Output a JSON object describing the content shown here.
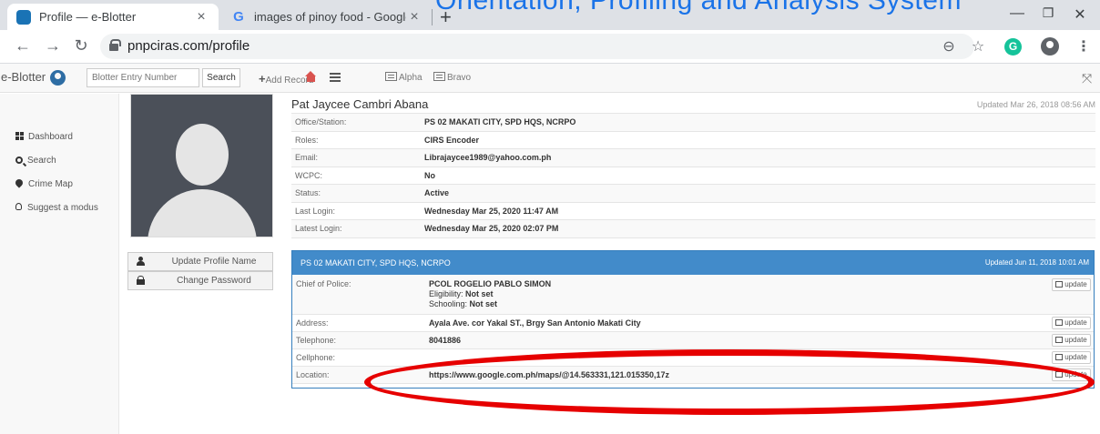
{
  "browser": {
    "tabs": [
      {
        "title": "Profile — e-Blotter",
        "active": true
      },
      {
        "title": "images of pinoy food - Google S",
        "active": false
      }
    ],
    "overlay_text": "Orientation, Profiling and Analysis System",
    "url": "pnpciras.com/profile",
    "colors": {
      "link_overlay": "#1a73e8",
      "tabstrip": "#dee1e6"
    }
  },
  "navbar": {
    "brand": "e-Blotter",
    "entry_placeholder": "Blotter Entry Number",
    "search_label": "Search",
    "add_record_label": "Add Record",
    "alpha_label": "Alpha",
    "bravo_label": "Bravo"
  },
  "sidebar": {
    "items": [
      {
        "label": "Dashboard",
        "icon": "grid-icon"
      },
      {
        "label": "Search",
        "icon": "search-icon"
      },
      {
        "label": "Crime Map",
        "icon": "map-marker-icon"
      },
      {
        "label": "Suggest a modus",
        "icon": "lightbulb-icon"
      }
    ]
  },
  "profile": {
    "buttons": {
      "update_name": "Update Profile Name",
      "change_password": "Change Password"
    },
    "name": "Pat Jaycee Cambri Abana",
    "updated": "Updated Mar 26, 2018 08:56 AM",
    "rows": [
      {
        "key": "Office/Station:",
        "value": "PS 02 MAKATI CITY, SPD HQS, NCRPO"
      },
      {
        "key": "Roles:",
        "value": "CIRS Encoder"
      },
      {
        "key": "Email:",
        "value": "Librajaycee1989@yahoo.com.ph"
      },
      {
        "key": "WCPC:",
        "value": "No"
      },
      {
        "key": "Status:",
        "value": "Active"
      },
      {
        "key": "Last Login:",
        "value": "Wednesday Mar 25, 2020 11:47 AM"
      },
      {
        "key": "Latest Login:",
        "value": "Wednesday Mar 25, 2020 02:07 PM"
      }
    ]
  },
  "station": {
    "title": "PS 02 MAKATI CITY, SPD HQS, NCRPO",
    "updated": "Updated Jun 11, 2018 10:01 AM",
    "update_label": "update",
    "chief": {
      "key": "Chief of Police:",
      "name": "PCOL ROGELIO PABLO SIMON",
      "eligibility_label": "Eligibility:",
      "eligibility": "Not set",
      "schooling_label": "Schooling:",
      "schooling": "Not set"
    },
    "rows": [
      {
        "key": "Address:",
        "value": "Ayala Ave. cor Yakal ST., Brgy San Antonio Makati City"
      },
      {
        "key": "Telephone:",
        "value": "8041886"
      },
      {
        "key": "Cellphone:",
        "value": ""
      },
      {
        "key": "Location:",
        "value": "https://www.google.com.ph/maps/@14.563331,121.015350,17z"
      }
    ],
    "colors": {
      "header": "#428bca",
      "annotation": "#e60000"
    }
  }
}
